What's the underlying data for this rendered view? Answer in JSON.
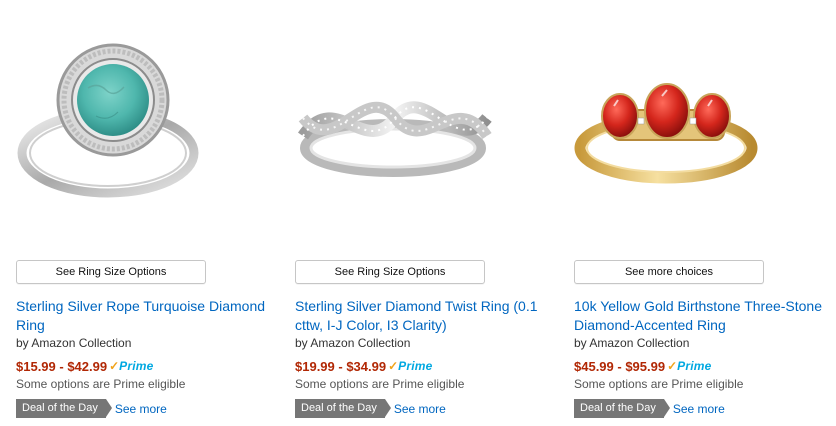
{
  "products": [
    {
      "options_label": "See Ring Size Options",
      "title": "Sterling Silver Rope Turquoise Diamond Ring",
      "brand": "by Amazon Collection",
      "price": "$15.99 - $42.99",
      "prime_label": "Prime",
      "eligibility": "Some options are Prime eligible",
      "deal_badge": "Deal of the Day",
      "see_more": "See more"
    },
    {
      "options_label": "See Ring Size Options",
      "title": "Sterling Silver Diamond Twist Ring (0.1 cttw, I-J Color, I3 Clarity)",
      "brand": "by Amazon Collection",
      "price": "$19.99 - $34.99",
      "prime_label": "Prime",
      "eligibility": "Some options are Prime eligible",
      "deal_badge": "Deal of the Day",
      "see_more": "See more"
    },
    {
      "options_label": "See more choices",
      "title": "10k Yellow Gold Birthstone Three-Stone Diamond-Accented Ring",
      "brand": "by Amazon Collection",
      "price": "$45.99 - $95.99",
      "prime_label": "Prime",
      "eligibility": "Some options are Prime eligible",
      "deal_badge": "Deal of the Day",
      "see_more": "See more"
    }
  ],
  "colors": {
    "link": "#0066c0",
    "price": "#b12704",
    "prime_blue": "#00a8e1",
    "prime_check": "#f0a31b",
    "deal_badge": "#767676"
  },
  "icons": [
    "prime-check-icon"
  ]
}
